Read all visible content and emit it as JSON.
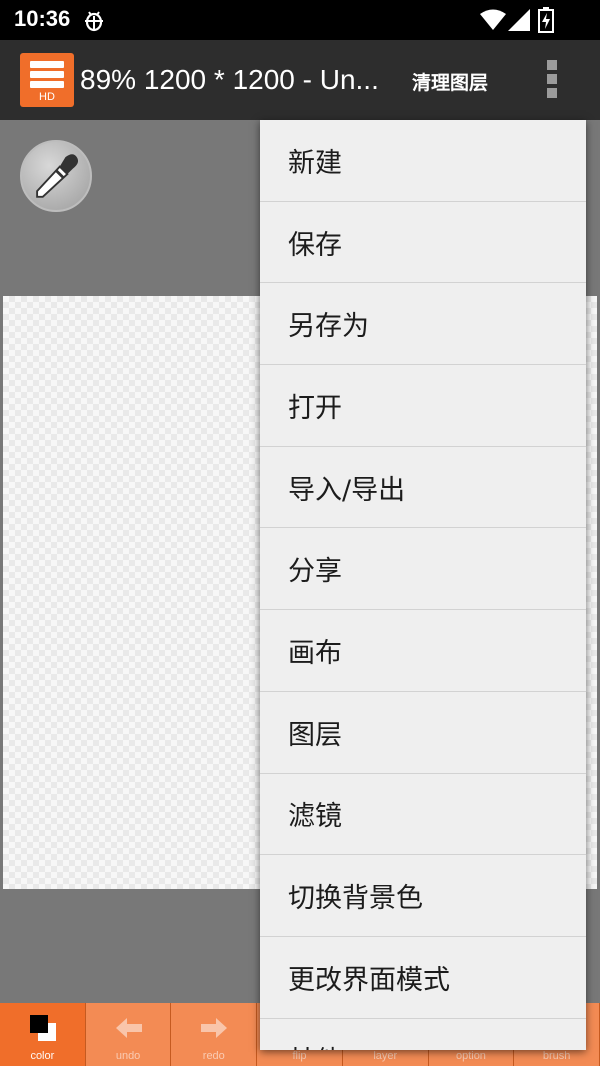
{
  "status_bar": {
    "time": "10:36"
  },
  "app_bar": {
    "logo_text": "HD",
    "title": "89% 1200 * 1200 - Un...",
    "clear_layer": "清理图层"
  },
  "menu": {
    "items": [
      "新建",
      "保存",
      "另存为",
      "打开",
      "导入/导出",
      "分享",
      "画布",
      "图层",
      "滤镜",
      "切换背景色",
      "更改界面模式",
      "其他"
    ]
  },
  "toolbar": {
    "tools": [
      {
        "label": "color",
        "icon": "color-swatch-icon"
      },
      {
        "label": "undo",
        "icon": "arrow-left-icon"
      },
      {
        "label": "redo",
        "icon": "arrow-right-icon"
      },
      {
        "label": "flip",
        "icon": "flip-icon"
      },
      {
        "label": "layer",
        "icon": "layer-icon"
      },
      {
        "label": "option",
        "icon": "option-icon"
      },
      {
        "label": "brush",
        "icon": "brush-icon"
      }
    ]
  },
  "colors": {
    "accent": "#f06e2a",
    "app_bar": "#2d2d2d",
    "menu_bg": "#efefef"
  }
}
